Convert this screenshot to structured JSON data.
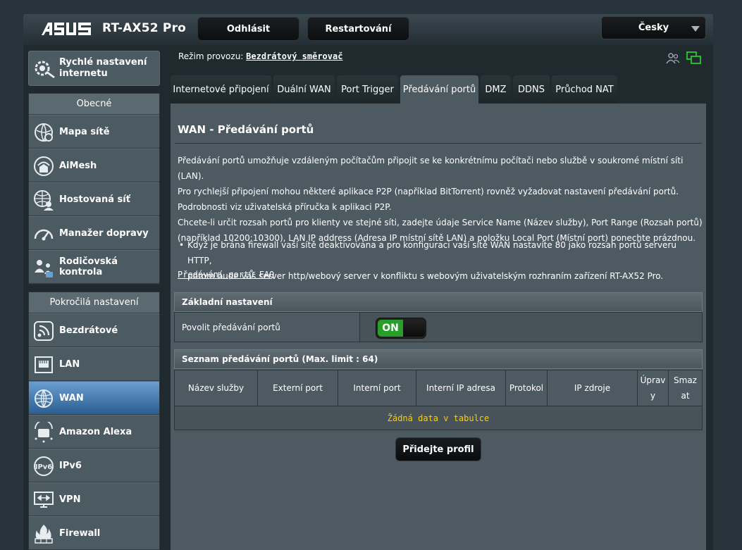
{
  "header": {
    "model": "RT-AX52 Pro",
    "logout_label": "Odhlásit",
    "restart_label": "Restartování",
    "language": "Česky"
  },
  "sidebar": {
    "quick_setup": "Rychlé nastavení internetu",
    "general_title": "Obecné",
    "general_items": [
      {
        "label": "Mapa sítě",
        "icon": "network-map-icon"
      },
      {
        "label": "AiMesh",
        "icon": "aimesh-icon"
      },
      {
        "label": "Hostovaná síť",
        "icon": "guest-network-icon"
      },
      {
        "label": "Manažer dopravy",
        "icon": "traffic-manager-icon"
      },
      {
        "label": "Rodičovská kontrola",
        "icon": "parental-control-icon"
      }
    ],
    "advanced_title": "Pokročilá nastavení",
    "advanced_items": [
      {
        "label": "Bezdrátové",
        "icon": "wireless-icon"
      },
      {
        "label": "LAN",
        "icon": "lan-icon"
      },
      {
        "label": "WAN",
        "icon": "wan-globe-icon",
        "active": true
      },
      {
        "label": "Amazon Alexa",
        "icon": "alexa-icon"
      },
      {
        "label": "IPv6",
        "icon": "ipv6-icon"
      },
      {
        "label": "VPN",
        "icon": "vpn-icon"
      },
      {
        "label": "Firewall",
        "icon": "firewall-icon"
      }
    ]
  },
  "mode": {
    "label": "Režim provozu:",
    "value": "Bezdrátový směrovač"
  },
  "tabs": [
    {
      "label": "Internetové připojení"
    },
    {
      "label": "Duální WAN"
    },
    {
      "label": "Port Trigger"
    },
    {
      "label": "Předávání portů",
      "active": true
    },
    {
      "label": "DMZ"
    },
    {
      "label": "DDNS"
    },
    {
      "label": "Průchod NAT"
    }
  ],
  "page": {
    "title": "WAN - Předávání portů",
    "desc_lines": [
      "Předávání portů umožňuje vzdáleným počítačům připojit se ke konkrétnímu počítači nebo službě v soukromé místní síti (LAN).",
      "Pro rychlejší připojení mohou některé aplikace P2P (například BitTorrent) rovněž vyžadovat nastavení předávání portů.",
      "Podrobnosti viz uživatelská příručka k aplikaci P2P.",
      "Chcete-li určit rozsah portů pro klienty ve stejné síti, zadejte údaje Service Name (Název služby), Port Range (Rozsah portů)",
      "(například 10200:10300), LAN IP address (Adresa IP místní sítě LAN) a položku Local Port (Místní port) ponechte prázdnou."
    ],
    "bullet_line1": "Když je brána firewall vaší sítě deaktivována a pro konfiguraci vaší sítě WAN nastavíte 80 jako rozsah portů serveru HTTP,",
    "bullet_line2": "potom bude váš server http/webový server v konfliktu s webovým uživatelským rozhraním zařízení RT-AX52 Pro.",
    "faq": "Předávání portů FAQ",
    "basic_title": "Základní nastavení",
    "enable_label": "Povolit předávání portů",
    "switch_on": "ON",
    "list_title": "Seznam předávání portů (Max. limit : 64)",
    "columns": [
      {
        "label": "Název služby"
      },
      {
        "label": "Externí port"
      },
      {
        "label": "Interní port"
      },
      {
        "label": "Interní IP adresa"
      },
      {
        "label": "Protokol"
      },
      {
        "label": "IP zdroje"
      },
      {
        "label": "Úprav y"
      },
      {
        "label": "Smaz at"
      }
    ],
    "empty": "Žádná data v tabulce",
    "add_label": "Přidejte profil"
  }
}
